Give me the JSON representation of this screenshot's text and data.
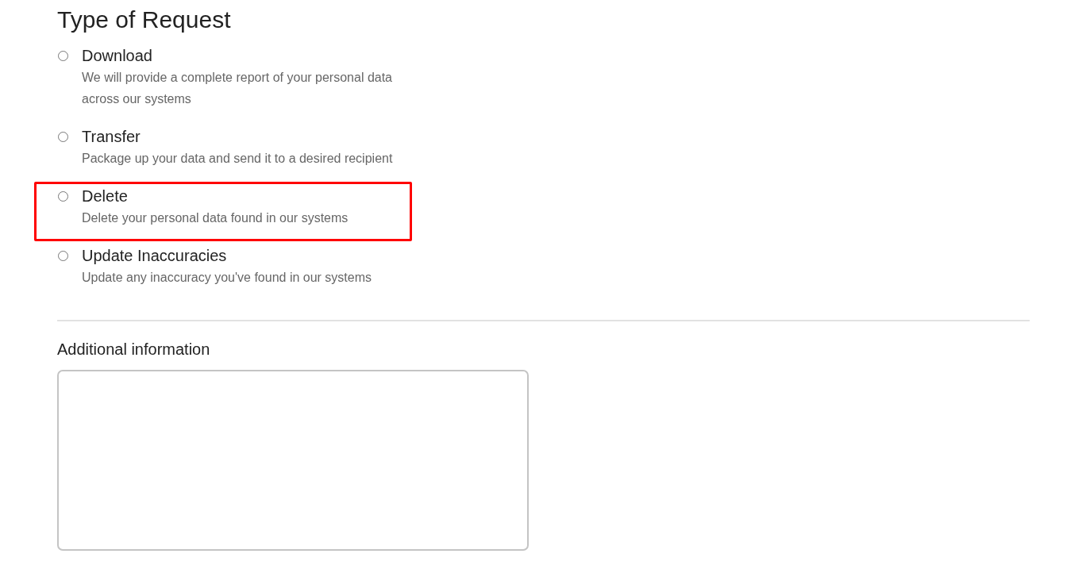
{
  "section": {
    "title": "Type of Request"
  },
  "options": [
    {
      "label": "Download",
      "description": "We will provide a complete report of your personal data across our systems",
      "selected": false,
      "highlighted": false
    },
    {
      "label": "Transfer",
      "description": "Package up your data and send it to a desired recipient",
      "selected": false,
      "highlighted": false
    },
    {
      "label": "Delete",
      "description": "Delete your personal data found in our systems",
      "selected": false,
      "highlighted": true
    },
    {
      "label": "Update Inaccuracies",
      "description": "Update any inaccuracy you've found in our systems",
      "selected": false,
      "highlighted": false
    }
  ],
  "additional_information": {
    "label": "Additional information"
  }
}
